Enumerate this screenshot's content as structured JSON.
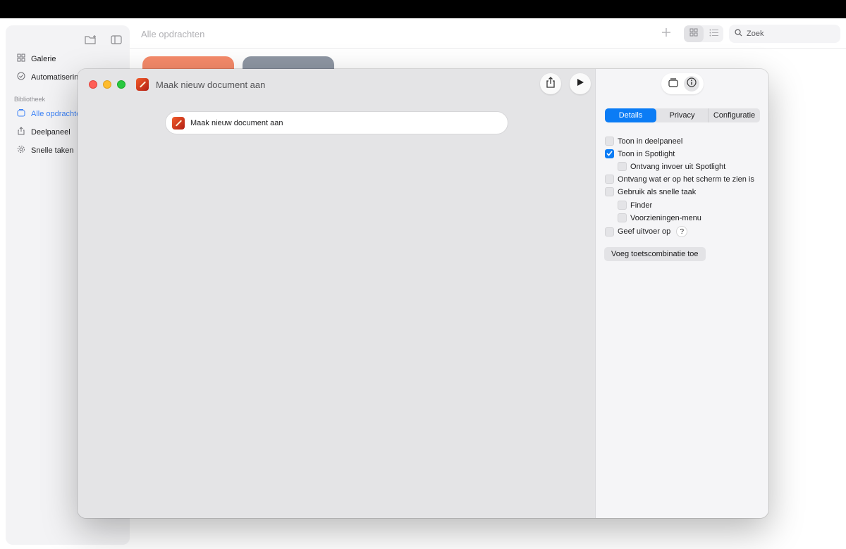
{
  "background_app": {
    "toolbar_title": "Alle opdrachten",
    "search_placeholder": "Zoek",
    "sidebar": {
      "items": [
        {
          "label": "Galerie",
          "icon": "grid-icon"
        },
        {
          "label": "Automatisering",
          "icon": "clock-check-icon"
        }
      ],
      "section_label": "Bibliotheek",
      "library_items": [
        {
          "label": "Alle opdrachten",
          "icon": "stack-icon",
          "active": true
        },
        {
          "label": "Deelpaneel",
          "icon": "share-icon"
        },
        {
          "label": "Snelle taken",
          "icon": "gear-icon"
        }
      ]
    },
    "card_colors": [
      "#f58a6a",
      "#8e96a3"
    ]
  },
  "editor": {
    "window_title": "Maak nieuw document aan",
    "action_label": "Maak nieuw document aan"
  },
  "inspector": {
    "tabs": [
      "Details",
      "Privacy",
      "Configuratie"
    ],
    "active_tab": "Details",
    "options": [
      {
        "label": "Toon in deelpaneel",
        "checked": false
      },
      {
        "label": "Toon in Spotlight",
        "checked": true
      },
      {
        "label": "Ontvang invoer uit Spotlight",
        "checked": false
      },
      {
        "label": "Ontvang wat er op het scherm te zien is",
        "checked": false
      },
      {
        "label": "Gebruik als snelle taak",
        "checked": false
      },
      {
        "label": "Finder",
        "checked": false
      },
      {
        "label": "Voorzieningen-menu",
        "checked": false
      },
      {
        "label": "Geef uitvoer op",
        "checked": false
      }
    ],
    "help_label": "?",
    "shortcut_button": "Voeg toetscombinatie toe"
  },
  "colors": {
    "accent": "#0b7cf5",
    "sidebar_active": "#3c82f6",
    "close": "#ff5f57",
    "minimize": "#febc2e",
    "zoom": "#28c840"
  }
}
